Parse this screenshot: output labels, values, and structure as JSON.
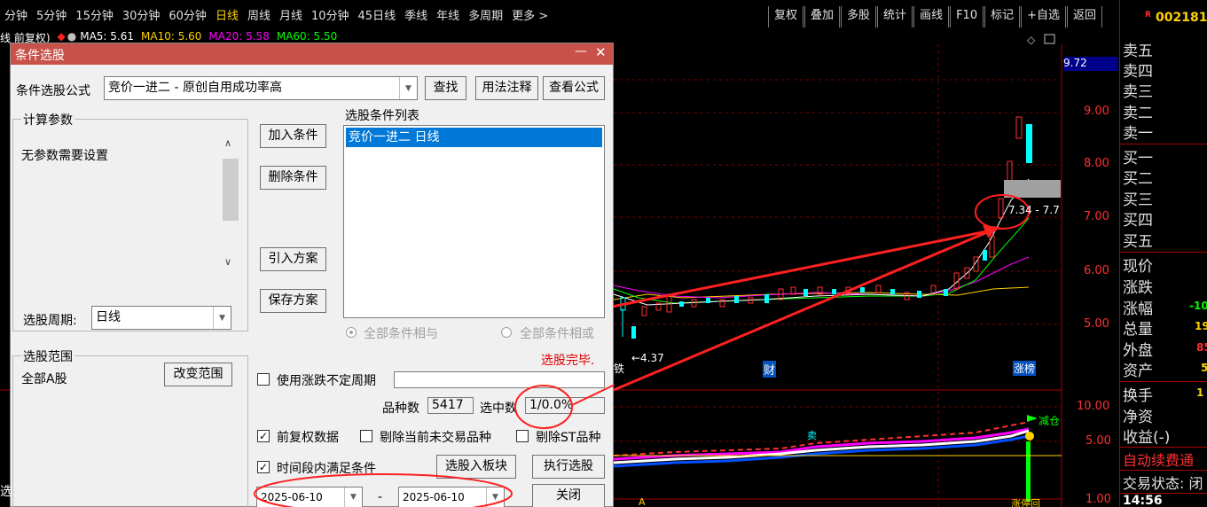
{
  "topbar": {
    "periods": [
      "分钟",
      "5分钟",
      "15分钟",
      "30分钟",
      "60分钟",
      "日线",
      "周线",
      "月线",
      "10分钟",
      "45日线",
      "季线",
      "年线",
      "多周期",
      "更多 >"
    ],
    "active_period": "日线",
    "tools": [
      "复权",
      "叠加",
      "多股",
      "统计",
      "画线",
      "F10",
      "标记",
      "+自选",
      "返回"
    ],
    "stock_badge": "R",
    "stock_code": "002181"
  },
  "ma_line": {
    "prefix": "线 前复权)",
    "ma5": "MA5: 5.61",
    "ma10": "MA10: 5.60",
    "ma20": "MA20: 5.58",
    "ma60": "MA60: 5.50",
    "colors": {
      "ma5": "#ffffff",
      "ma10": "#ffd100",
      "ma20": "#ff00ff",
      "ma60": "#00ff00"
    }
  },
  "chart": {
    "price_ticks": [
      "9.72",
      "9.00",
      "8.00",
      "7.00",
      "6.00",
      "5.00"
    ],
    "sub_ticks": [
      "10.00",
      "5.00",
      "1.00"
    ],
    "price_range_label": "7.34 - 7.7",
    "low_label": "←4.37",
    "markers": {
      "cai": "财",
      "bang": "涨榜",
      "jian": "减仓",
      "mai": "卖",
      "tie": "铁",
      "zhang": "涨停回",
      "bottom_a": "A"
    },
    "colors": {
      "axis": "#ff3030",
      "up": "#ff3030",
      "down": "#00ffff",
      "arrow": "#ff2020"
    }
  },
  "quote_panel": {
    "sell": [
      "卖五",
      "卖四",
      "卖三",
      "卖二",
      "卖一"
    ],
    "buy": [
      "买一",
      "买二",
      "买三",
      "买四",
      "买五"
    ],
    "stats": [
      "现价",
      "涨跌",
      "涨幅",
      "总量",
      "外盘",
      "资产"
    ],
    "stat_values": {
      "zhangfu": "-10",
      "zongliang": "19",
      "waipan": "85",
      "zichan": "5"
    },
    "extra": [
      "换手",
      "净资",
      "收益(-)"
    ],
    "extra_values": {
      "huanshou": "1"
    },
    "auto_fee": "自动续费通",
    "trade_status": "交易状态: 闭",
    "time": "14:56"
  },
  "dialog": {
    "title": "条件选股",
    "formula_label": "条件选股公式",
    "formula_value": "竞价一进二  -  原创自用成功率高",
    "btn_find": "查找",
    "btn_usage": "用法注释",
    "btn_view": "查看公式",
    "params_group": "计算参数",
    "params_text": "无参数需要设置",
    "list_label": "选股条件列表",
    "list_item": "竞价一进二  日线",
    "btn_add": "加入条件",
    "btn_delete": "删除条件",
    "btn_import": "引入方案",
    "btn_save": "保存方案",
    "period_label": "选股周期:",
    "period_value": "日线",
    "radio_and": "全部条件相与",
    "radio_or": "全部条件相或",
    "status_done": "选股完毕.",
    "scope_group": "选股范围",
    "scope_value": "全部A股",
    "btn_scope": "改变范围",
    "chk_uncertain": "使用涨跌不定周期",
    "count_label": "品种数",
    "count_value": "5417",
    "selected_label": "选中数",
    "selected_value": "1/0.0%",
    "chk_adjust": "前复权数据",
    "chk_exclude_nontrade": "剔除当前未交易品种",
    "chk_exclude_st": "剔除ST品种",
    "chk_time": "时间段内满足条件",
    "btn_to_block": "选股入板块",
    "btn_run": "执行选股",
    "date_from": "2025-06-10",
    "date_sep": "-",
    "date_to": "2025-06-10",
    "btn_close": "关闭"
  }
}
